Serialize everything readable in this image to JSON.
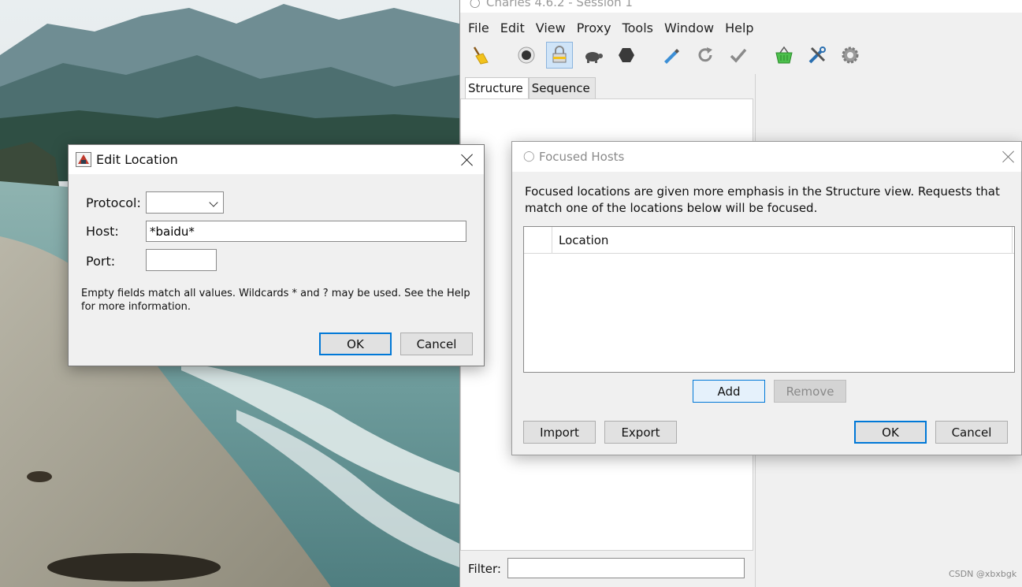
{
  "charles": {
    "window_title": "Charles 4.6.2 - Session 1",
    "menu": [
      "File",
      "Edit",
      "View",
      "Proxy",
      "Tools",
      "Window",
      "Help"
    ],
    "toolbar": [
      {
        "name": "broom-icon"
      },
      {
        "name": "record-icon"
      },
      {
        "name": "ssl-proxying-lock-icon",
        "active": true
      },
      {
        "name": "throttle-turtle-icon"
      },
      {
        "name": "breakpoints-hexagon-icon"
      },
      {
        "name": "compose-pen-icon"
      },
      {
        "name": "repeat-icon"
      },
      {
        "name": "validate-check-icon"
      },
      {
        "name": "basket-icon"
      },
      {
        "name": "tools-icon"
      },
      {
        "name": "settings-gear-icon"
      }
    ],
    "tabs": [
      {
        "label": "Structure",
        "selected": true
      },
      {
        "label": "Sequence",
        "selected": false
      }
    ],
    "filter_label": "Filter:",
    "filter_value": ""
  },
  "edit_location": {
    "title": "Edit Location",
    "protocol_label": "Protocol:",
    "protocol_value": "",
    "host_label": "Host:",
    "host_value": "*baidu*",
    "port_label": "Port:",
    "port_value": "",
    "help_text": "Empty fields match all values. Wildcards * and ? may be used. See the Help for more information.",
    "ok_label": "OK",
    "cancel_label": "Cancel"
  },
  "focused_hosts": {
    "title": "Focused Hosts",
    "description": "Focused locations are given more emphasis in the Structure view.  Requests that match one of the locations below will be focused.",
    "table_header": "Location",
    "rows": [],
    "add_label": "Add",
    "remove_label": "Remove",
    "import_label": "Import",
    "export_label": "Export",
    "ok_label": "OK",
    "cancel_label": "Cancel"
  },
  "watermark": "CSDN @xbxbgk",
  "colors": {
    "focus_border": "#0078d7",
    "dialog_bg": "#f0f0f0",
    "active_toolbar": "#cfe4f8"
  }
}
